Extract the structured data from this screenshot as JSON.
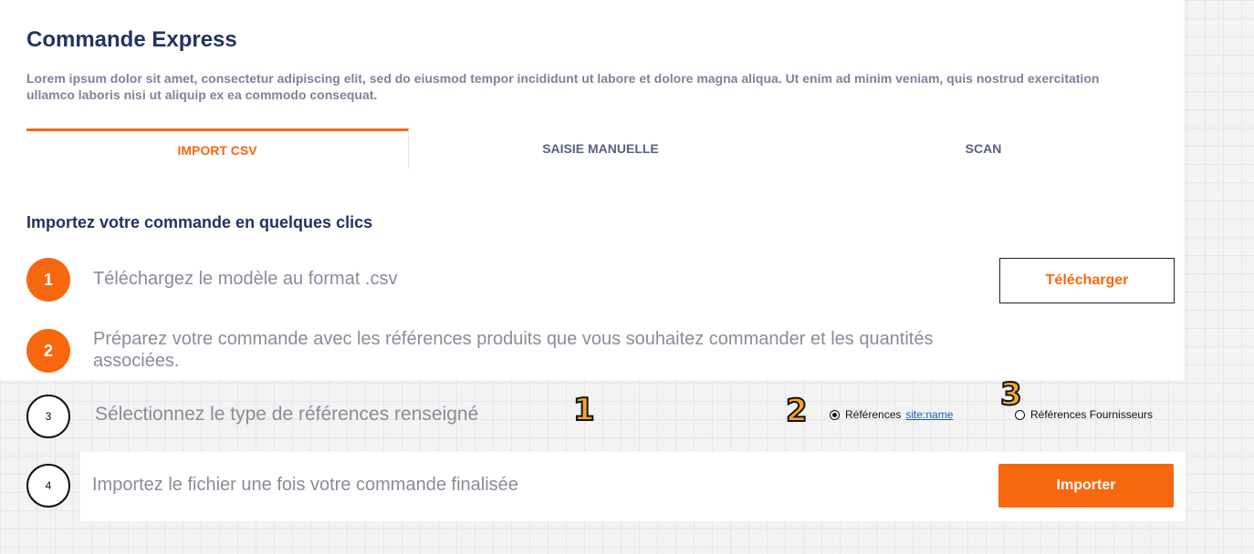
{
  "page": {
    "title": "Commande Express",
    "intro": "Lorem ipsum dolor sit amet, consectetur adipiscing elit, sed do eiusmod tempor incididunt ut labore et dolore magna aliqua. Ut enim ad minim veniam, quis nostrud exercitation ullamco laboris nisi ut aliquip ex ea commodo consequat."
  },
  "tabs": [
    {
      "label": "IMPORT CSV",
      "active": true
    },
    {
      "label": "SAISIE MANUELLE",
      "active": false
    },
    {
      "label": "SCAN",
      "active": false
    }
  ],
  "section": {
    "title": "Importez votre commande en quelques clics"
  },
  "steps": [
    {
      "number": "1",
      "text": "Téléchargez le modèle au format .csv",
      "button": "Télécharger"
    },
    {
      "number": "2",
      "text": "Préparez votre commande avec les références produits que vous souhaitez commander et les quantités associées."
    },
    {
      "number": "3",
      "text": "Sélectionnez le type de références renseigné"
    },
    {
      "number": "4",
      "text": "Importez le fichier une fois votre commande finalisée",
      "button": "Importer"
    }
  ],
  "reference_options": {
    "option1": {
      "label": "Références",
      "link": "site:name",
      "selected": true
    },
    "option2": {
      "label": "Références Fournisseurs",
      "selected": false
    }
  },
  "annotations": [
    "1",
    "2",
    "3"
  ],
  "colors": {
    "accent": "#f7670f",
    "heading": "#24335f",
    "annotation": "#f7a52a"
  }
}
